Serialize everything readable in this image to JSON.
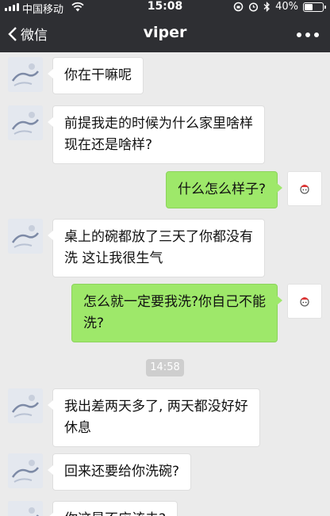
{
  "status_bar": {
    "carrier": "中国移动",
    "time": "15:08",
    "battery": "40%",
    "battery_level": 0.4
  },
  "nav": {
    "back_label": "微信",
    "title": "viper"
  },
  "messages": [
    {
      "side": "left",
      "text": "你在干嘛呢"
    },
    {
      "side": "left",
      "text": "前提我走的时候为什么家里啥样\n现在还是啥样?"
    },
    {
      "side": "right",
      "text": "什么怎么样子?"
    },
    {
      "side": "left",
      "text": "桌上的碗都放了三天了你都没有\n洗 这让我很生气"
    },
    {
      "side": "right",
      "text": "怎么就一定要我洗?你自己不能\n洗?"
    },
    {
      "type": "time",
      "text": "14:58"
    },
    {
      "side": "left",
      "text": "我出差两天多了, 两天都没好好\n休息"
    },
    {
      "side": "left",
      "text": "回来还要给你洗碗?"
    },
    {
      "side": "left",
      "text": "你这是不应该去?"
    }
  ],
  "colors": {
    "nav_background": "#2e2f33",
    "chat_background": "#ebebeb",
    "sent_bubble": "#9ee86a",
    "received_bubble": "#ffffff"
  }
}
